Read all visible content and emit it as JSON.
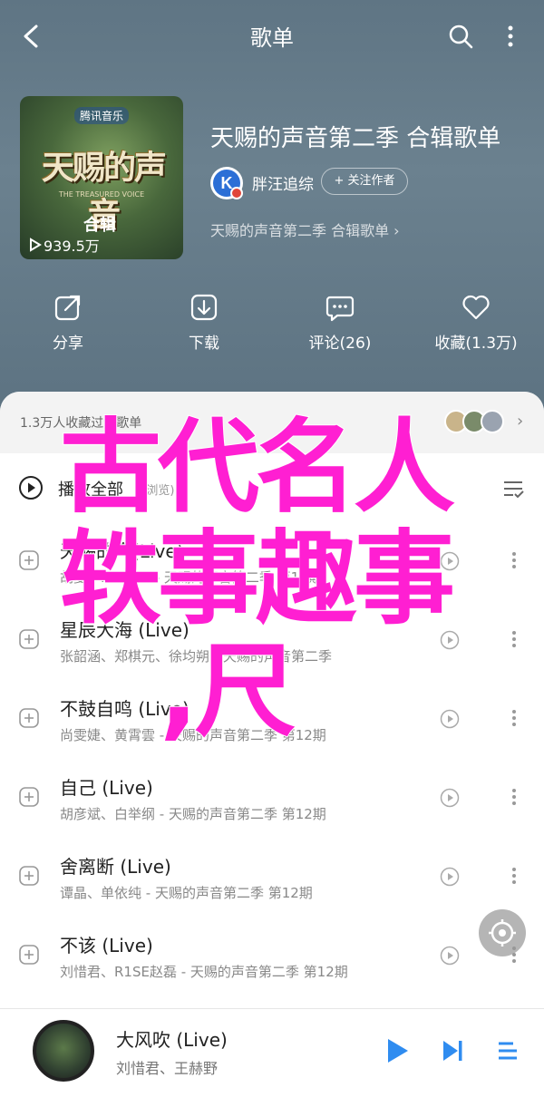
{
  "top_bar": {
    "title": "歌单"
  },
  "album": {
    "cover_logo": "腾讯音乐",
    "cover_title": "天赐的声音",
    "cover_subtitle": "THE TREASURED VOICE",
    "cover_tag": "合辑",
    "plays": "939.5万",
    "title": "天赐的声音第二季 合辑歌单",
    "creator": "胖汪追综",
    "follow_label": "+ 关注作者",
    "description": "天赐的声音第二季 合辑歌单 ›"
  },
  "actions": {
    "share": "分享",
    "download": "下载",
    "comment": "评论(26)",
    "favorite": "收藏(1.3万)"
  },
  "favorites": {
    "text": "1.3万人收藏过该歌单"
  },
  "play_all": {
    "label": "播放全部",
    "count": "(5浏览)"
  },
  "songs": [
    {
      "name": "天赐的声(Live)",
      "meta": "胡夏、NEOMS - 天赐的声音第二季 第12期"
    },
    {
      "name": "星辰大海 (Live)",
      "meta": "张韶涵、郑棋元、徐均朔 - 天赐的声音第二季"
    },
    {
      "name": "不鼓自鸣 (Live)",
      "meta": "尚雯婕、黄霄雲 - 天赐的声音第二季 第12期"
    },
    {
      "name": "自己 (Live)",
      "meta": "胡彦斌、白举纲 - 天赐的声音第二季 第12期"
    },
    {
      "name": "舍离断 (Live)",
      "meta": "谭晶、单依纯 - 天赐的声音第二季 第12期"
    },
    {
      "name": "不该 (Live)",
      "meta": "刘惜君、R1SE赵磊 - 天赐的声音第二季 第12期"
    }
  ],
  "player": {
    "title": "大风吹 (Live)",
    "artist": "刘惜君、王赫野"
  },
  "overlay": {
    "line1": "古代名人",
    "line2": "轶事趣事",
    "line3": ",尺"
  },
  "colors": {
    "header_bg": "#6b818f",
    "accent_play": "#2f8cf0",
    "overlay_text": "#ff1fd2"
  }
}
